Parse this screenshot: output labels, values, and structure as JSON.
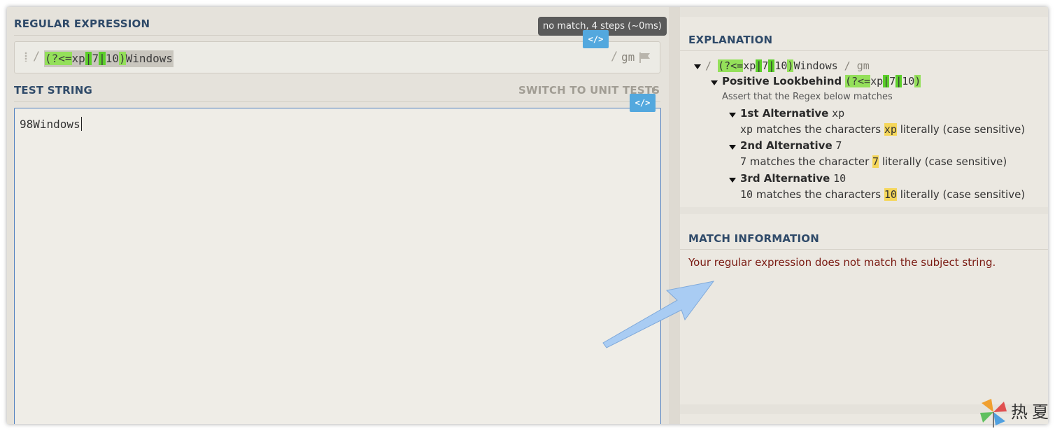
{
  "regex_panel": {
    "title": "REGULAR EXPRESSION",
    "status_badge": "no match, 4 steps (~0ms)",
    "code_button_label": "</>",
    "delimiter_open": "/",
    "delimiter_close": "/",
    "flags": "gm",
    "pattern_tokens": {
      "lookbehind_open": "(?<=",
      "alt1": "xp",
      "pipe1": "|",
      "alt2": "7",
      "pipe2": "|",
      "alt3": "10",
      "group_close": ")",
      "literal": "Windows"
    }
  },
  "test_panel": {
    "title": "TEST STRING",
    "unit_tests_link": "SWITCH TO UNIT TESTS",
    "code_button_label": "</>",
    "value": "98Windows"
  },
  "explanation": {
    "title": "EXPLANATION",
    "root": {
      "slash_open": "/ ",
      "lookbehind_open": "(?<=",
      "alt1": "xp",
      "pipe1": "|",
      "alt2": "7",
      "pipe2": "|",
      "alt3": "10",
      "group_close": ")",
      "literal": "Windows",
      "slash_close": " / gm"
    },
    "lookbehind": {
      "label": "Positive Lookbehind",
      "code_open": "(?<=",
      "alt1": "xp",
      "pipe1": "|",
      "alt2": "7",
      "pipe2": "|",
      "alt3": "10",
      "code_close": ")",
      "description": "Assert that the Regex below matches"
    },
    "alternatives": [
      {
        "label": "1st Alternative",
        "code": "xp",
        "desc_code": "xp",
        "desc_mid": " matches the characters ",
        "desc_hl": "xp",
        "desc_end": " literally (case sensitive)"
      },
      {
        "label": "2nd Alternative",
        "code": "7",
        "desc_code": "7",
        "desc_mid": " matches the character ",
        "desc_hl": "7",
        "desc_end": " literally (case sensitive)"
      },
      {
        "label": "3rd Alternative",
        "code": "10",
        "desc_code": "10",
        "desc_mid": " matches the characters ",
        "desc_hl": "10",
        "desc_end": " literally (case sensitive)"
      }
    ]
  },
  "match_info": {
    "title": "MATCH INFORMATION",
    "message": "Your regular expression does not match the subject string."
  },
  "watermark": {
    "text": "热夏"
  },
  "colors": {
    "group_highlight": "#94e05a",
    "alternation_highlight": "#5ccf2a",
    "literal_highlight": "#f5d65a",
    "title_color": "#2f4a69",
    "error_color": "#7a1a12",
    "code_button": "#53a8de",
    "arrow": "#a9ccf3"
  }
}
